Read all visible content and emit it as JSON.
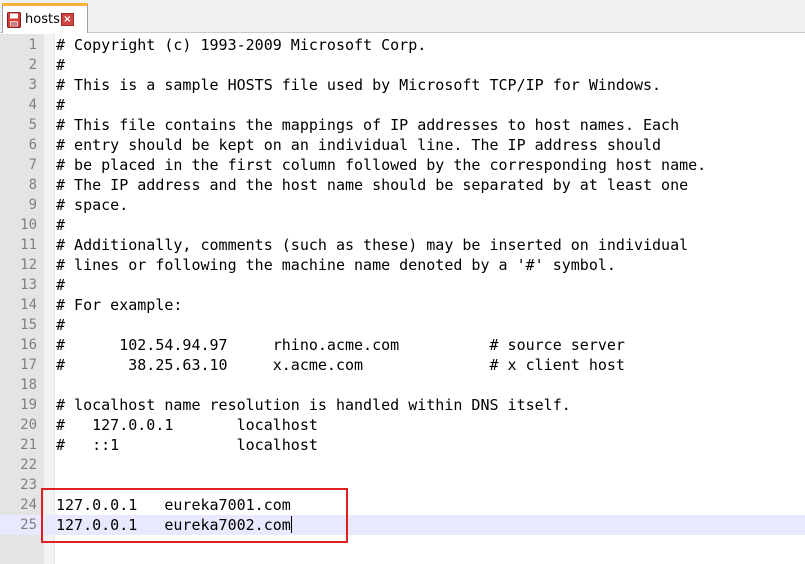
{
  "tab": {
    "label": "hosts",
    "close_glyph": "×",
    "file_icon": "floppy-disk-red-icon"
  },
  "colors": {
    "tab_accent": "#f7b23b",
    "current_line": "#e8e8ff",
    "annotation_box": "#e02020",
    "line_number": "#808080"
  },
  "editor": {
    "current_line": 25,
    "lines": [
      {
        "n": "1",
        "text": "# Copyright (c) 1993-2009 Microsoft Corp."
      },
      {
        "n": "2",
        "text": "#"
      },
      {
        "n": "3",
        "text": "# This is a sample HOSTS file used by Microsoft TCP/IP for Windows."
      },
      {
        "n": "4",
        "text": "#"
      },
      {
        "n": "5",
        "text": "# This file contains the mappings of IP addresses to host names. Each"
      },
      {
        "n": "6",
        "text": "# entry should be kept on an individual line. The IP address should"
      },
      {
        "n": "7",
        "text": "# be placed in the first column followed by the corresponding host name."
      },
      {
        "n": "8",
        "text": "# The IP address and the host name should be separated by at least one"
      },
      {
        "n": "9",
        "text": "# space."
      },
      {
        "n": "10",
        "text": "#"
      },
      {
        "n": "11",
        "text": "# Additionally, comments (such as these) may be inserted on individual"
      },
      {
        "n": "12",
        "text": "# lines or following the machine name denoted by a '#' symbol."
      },
      {
        "n": "13",
        "text": "#"
      },
      {
        "n": "14",
        "text": "# For example:"
      },
      {
        "n": "15",
        "text": "#"
      },
      {
        "n": "16",
        "text": "#      102.54.94.97     rhino.acme.com          # source server"
      },
      {
        "n": "17",
        "text": "#       38.25.63.10     x.acme.com              # x client host"
      },
      {
        "n": "18",
        "text": ""
      },
      {
        "n": "19",
        "text": "# localhost name resolution is handled within DNS itself."
      },
      {
        "n": "20",
        "text": "#   127.0.0.1       localhost"
      },
      {
        "n": "21",
        "text": "#   ::1             localhost"
      },
      {
        "n": "22",
        "text": ""
      },
      {
        "n": "23",
        "text": ""
      },
      {
        "n": "24",
        "text": "127.0.0.1   eureka7001.com"
      },
      {
        "n": "25",
        "text": "127.0.0.1   eureka7002.com"
      }
    ]
  }
}
